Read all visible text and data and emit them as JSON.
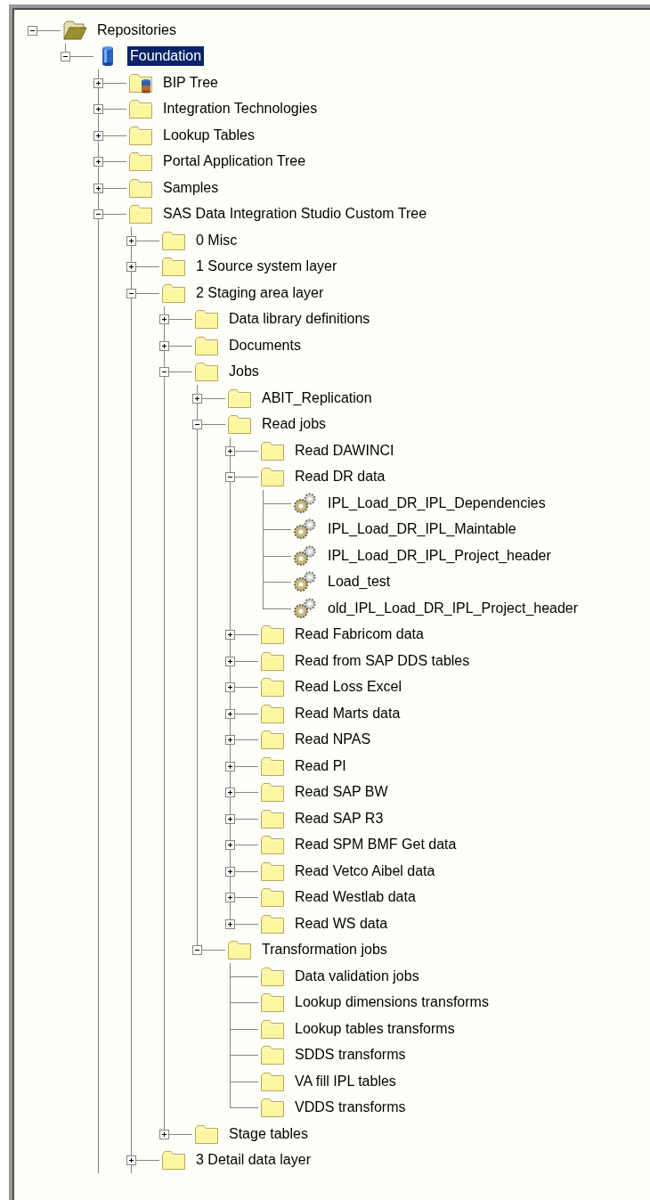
{
  "tree": {
    "items": [
      {
        "label": "Repositories",
        "kind": "open_folder",
        "expanded": true,
        "selected": false,
        "children": [
          {
            "label": "Foundation",
            "kind": "repository",
            "expanded": true,
            "selected": true,
            "cut_off": true,
            "children": [
              {
                "label": "BIP Tree",
                "kind": "folder_repository",
                "expanded": false,
                "selected": false
              },
              {
                "label": "Integration Technologies",
                "kind": "folder",
                "expanded": false,
                "selected": false
              },
              {
                "label": "Lookup Tables",
                "kind": "folder",
                "expanded": false,
                "selected": false
              },
              {
                "label": "Portal Application Tree",
                "kind": "folder",
                "expanded": false,
                "selected": false
              },
              {
                "label": "Samples",
                "kind": "folder",
                "expanded": false,
                "selected": false
              },
              {
                "label": "SAS Data Integration Studio Custom Tree",
                "kind": "folder",
                "expanded": true,
                "selected": false,
                "cut_off": true,
                "children": [
                  {
                    "label": "0 Misc",
                    "kind": "folder",
                    "expanded": false,
                    "selected": false
                  },
                  {
                    "label": "1 Source system layer",
                    "kind": "folder",
                    "expanded": false,
                    "selected": false
                  },
                  {
                    "label": "2 Staging area layer",
                    "kind": "folder",
                    "expanded": true,
                    "selected": false,
                    "children": [
                      {
                        "label": "Data library definitions",
                        "kind": "folder",
                        "expanded": false,
                        "selected": false
                      },
                      {
                        "label": "Documents",
                        "kind": "folder",
                        "expanded": false,
                        "selected": false
                      },
                      {
                        "label": "Jobs",
                        "kind": "folder",
                        "expanded": true,
                        "selected": false,
                        "children": [
                          {
                            "label": "ABIT_Replication",
                            "kind": "folder",
                            "expanded": false,
                            "selected": false
                          },
                          {
                            "label": "Read jobs",
                            "kind": "folder",
                            "expanded": true,
                            "selected": false,
                            "children": [
                              {
                                "label": "Read DAWINCI",
                                "kind": "folder",
                                "expanded": false,
                                "selected": false
                              },
                              {
                                "label": "Read DR data",
                                "kind": "folder",
                                "expanded": true,
                                "selected": false,
                                "children": [
                                  {
                                    "label": "IPL_Load_DR_IPL_Dependencies",
                                    "kind": "job",
                                    "selected": false
                                  },
                                  {
                                    "label": "IPL_Load_DR_IPL_Maintable",
                                    "kind": "job",
                                    "selected": false
                                  },
                                  {
                                    "label": "IPL_Load_DR_IPL_Project_header",
                                    "kind": "job",
                                    "selected": false
                                  },
                                  {
                                    "label": "Load_test",
                                    "kind": "job",
                                    "selected": false
                                  },
                                  {
                                    "label": "old_IPL_Load_DR_IPL_Project_header",
                                    "kind": "job",
                                    "selected": false
                                  }
                                ]
                              },
                              {
                                "label": "Read Fabricom data",
                                "kind": "folder",
                                "expanded": false,
                                "selected": false
                              },
                              {
                                "label": "Read from SAP DDS tables",
                                "kind": "folder",
                                "expanded": false,
                                "selected": false
                              },
                              {
                                "label": "Read Loss Excel",
                                "kind": "folder",
                                "expanded": false,
                                "selected": false
                              },
                              {
                                "label": "Read Marts data",
                                "kind": "folder",
                                "expanded": false,
                                "selected": false
                              },
                              {
                                "label": "Read NPAS",
                                "kind": "folder",
                                "expanded": false,
                                "selected": false
                              },
                              {
                                "label": "Read PI",
                                "kind": "folder",
                                "expanded": false,
                                "selected": false
                              },
                              {
                                "label": "Read SAP BW",
                                "kind": "folder",
                                "expanded": false,
                                "selected": false
                              },
                              {
                                "label": "Read SAP R3",
                                "kind": "folder",
                                "expanded": false,
                                "selected": false
                              },
                              {
                                "label": "Read SPM BMF Get data",
                                "kind": "folder",
                                "expanded": false,
                                "selected": false
                              },
                              {
                                "label": "Read Vetco Aibel data",
                                "kind": "folder",
                                "expanded": false,
                                "selected": false
                              },
                              {
                                "label": "Read Westlab data",
                                "kind": "folder",
                                "expanded": false,
                                "selected": false
                              },
                              {
                                "label": "Read WS data",
                                "kind": "folder",
                                "expanded": false,
                                "selected": false
                              }
                            ]
                          },
                          {
                            "label": "Transformation jobs",
                            "kind": "folder",
                            "expanded": true,
                            "selected": false,
                            "children": [
                              {
                                "label": "Data validation jobs",
                                "kind": "folder",
                                "selected": false
                              },
                              {
                                "label": "Lookup dimensions transforms",
                                "kind": "folder",
                                "selected": false
                              },
                              {
                                "label": "Lookup tables transforms",
                                "kind": "folder",
                                "selected": false
                              },
                              {
                                "label": "SDDS transforms",
                                "kind": "folder",
                                "selected": false
                              },
                              {
                                "label": "VA fill IPL tables",
                                "kind": "folder",
                                "selected": false
                              },
                              {
                                "label": "VDDS transforms",
                                "kind": "folder",
                                "selected": false
                              }
                            ]
                          }
                        ]
                      },
                      {
                        "label": "Stage tables",
                        "kind": "folder",
                        "expanded": false,
                        "selected": false
                      }
                    ]
                  },
                  {
                    "label": "3 Detail data layer",
                    "kind": "folder",
                    "expanded": false,
                    "selected": false
                  }
                ]
              }
            ]
          }
        ]
      }
    ]
  }
}
